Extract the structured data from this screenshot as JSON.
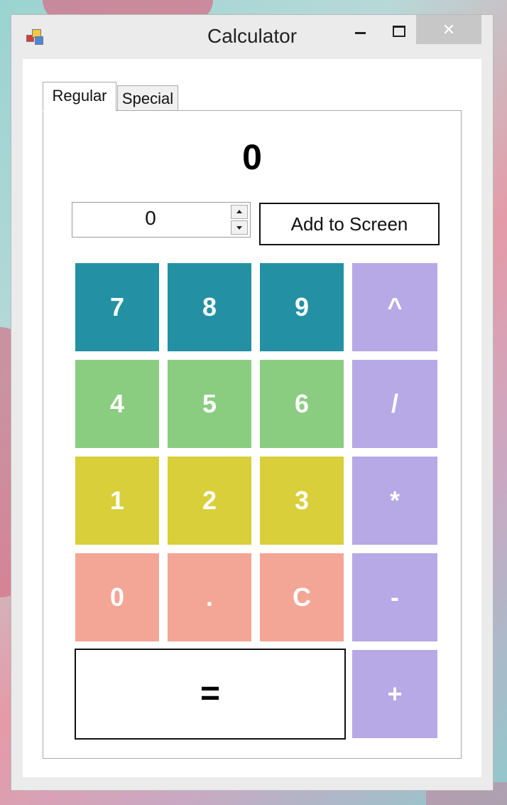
{
  "window": {
    "title": "Calculator",
    "close_glyph": "✕"
  },
  "tabs": [
    {
      "label": "Regular",
      "selected": true
    },
    {
      "label": "Special",
      "selected": false
    }
  ],
  "display": {
    "value": "0"
  },
  "number_input": {
    "value": "0"
  },
  "add_button": {
    "label": "Add to Screen"
  },
  "keys": {
    "seven": "7",
    "eight": "8",
    "nine": "9",
    "power": "^",
    "four": "4",
    "five": "5",
    "six": "6",
    "divide": "/",
    "one": "1",
    "two": "2",
    "three": "3",
    "multiply": "*",
    "zero": "0",
    "dot": ".",
    "clear": "C",
    "minus": "-",
    "equals": "=",
    "plus": "+"
  },
  "colors": {
    "row1": "#2391a3",
    "row2": "#8acd80",
    "row3": "#d8cf3a",
    "row4": "#f3a696",
    "operators": "#b7a8e6"
  }
}
